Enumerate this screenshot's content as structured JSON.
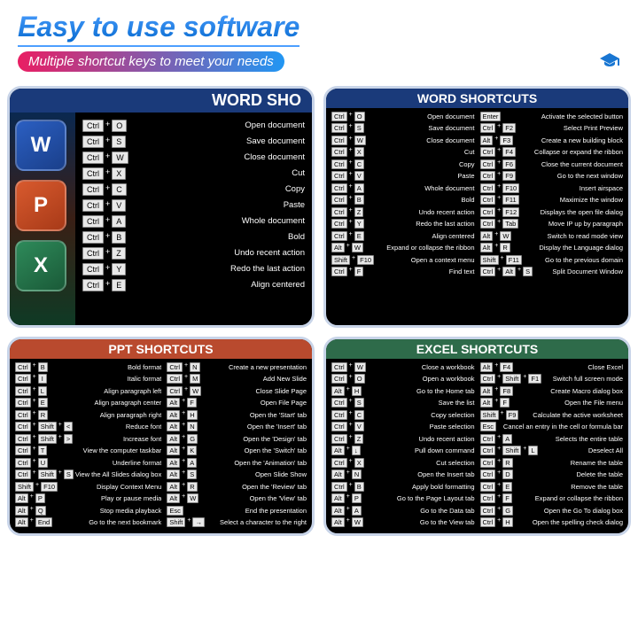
{
  "header": {
    "title": "Easy to use software",
    "subtitle": "Multiple shortcut keys to meet your needs"
  },
  "apps": {
    "w": "W",
    "p": "P",
    "x": "X"
  },
  "panels": {
    "zoom": {
      "title": "WORD SHO",
      "rows": [
        {
          "k": [
            "Ctrl",
            "O"
          ],
          "d": "Open document"
        },
        {
          "k": [
            "Ctrl",
            "S"
          ],
          "d": "Save document"
        },
        {
          "k": [
            "Ctrl",
            "W"
          ],
          "d": "Close document"
        },
        {
          "k": [
            "Ctrl",
            "X"
          ],
          "d": "Cut"
        },
        {
          "k": [
            "Ctrl",
            "C"
          ],
          "d": "Copy"
        },
        {
          "k": [
            "Ctrl",
            "V"
          ],
          "d": "Paste"
        },
        {
          "k": [
            "Ctrl",
            "A"
          ],
          "d": "Whole document"
        },
        {
          "k": [
            "Ctrl",
            "B"
          ],
          "d": "Bold"
        },
        {
          "k": [
            "Ctrl",
            "Z"
          ],
          "d": "Undo recent action"
        },
        {
          "k": [
            "Ctrl",
            "Y"
          ],
          "d": "Redo the last action"
        },
        {
          "k": [
            "Ctrl",
            "E"
          ],
          "d": "Align centered"
        }
      ]
    },
    "word": {
      "title": "WORD SHORTCUTS",
      "left": [
        {
          "k": [
            "Ctrl",
            "O"
          ],
          "d": "Open document"
        },
        {
          "k": [
            "Ctrl",
            "S"
          ],
          "d": "Save document"
        },
        {
          "k": [
            "Ctrl",
            "W"
          ],
          "d": "Close document"
        },
        {
          "k": [
            "Ctrl",
            "X"
          ],
          "d": "Cut"
        },
        {
          "k": [
            "Ctrl",
            "C"
          ],
          "d": "Copy"
        },
        {
          "k": [
            "Ctrl",
            "V"
          ],
          "d": "Paste"
        },
        {
          "k": [
            "Ctrl",
            "A"
          ],
          "d": "Whole document"
        },
        {
          "k": [
            "Ctrl",
            "B"
          ],
          "d": "Bold"
        },
        {
          "k": [
            "Ctrl",
            "Z"
          ],
          "d": "Undo recent action"
        },
        {
          "k": [
            "Ctrl",
            "Y"
          ],
          "d": "Redo the last action"
        },
        {
          "k": [
            "Ctrl",
            "E"
          ],
          "d": "Align centered"
        },
        {
          "k": [
            "Alt",
            "W"
          ],
          "d": "Expand or collapse the ribbon"
        },
        {
          "k": [
            "Shift",
            "F10"
          ],
          "d": "Open a context menu"
        },
        {
          "k": [
            "Ctrl",
            "F"
          ],
          "d": "Find text"
        }
      ],
      "right": [
        {
          "k": [
            "Enter"
          ],
          "d": "Activate the selected button"
        },
        {
          "k": [
            "Ctrl",
            "F2"
          ],
          "d": "Select Print Preview"
        },
        {
          "k": [
            "Alt",
            "F3"
          ],
          "d": "Create a new building block"
        },
        {
          "k": [
            "Ctrl",
            "F4"
          ],
          "d": "Collapse or expand the ribbon"
        },
        {
          "k": [
            "Ctrl",
            "F6"
          ],
          "d": "Close the current document"
        },
        {
          "k": [
            "Ctrl",
            "F9"
          ],
          "d": "Go to the next window"
        },
        {
          "k": [
            "Ctrl",
            "F10"
          ],
          "d": "Insert airspace"
        },
        {
          "k": [
            "Ctrl",
            "F11"
          ],
          "d": "Maximize the window"
        },
        {
          "k": [
            "Ctrl",
            "F12"
          ],
          "d": "Displays the open file dialog"
        },
        {
          "k": [
            "Ctrl",
            "Tab"
          ],
          "d": "Move IP up by paragraph"
        },
        {
          "k": [
            "Alt",
            "W"
          ],
          "d": "Switch to read mode view"
        },
        {
          "k": [
            "Alt",
            "R"
          ],
          "d": "Display the Language dialog"
        },
        {
          "k": [
            "Shift",
            "F11"
          ],
          "d": "Go to the previous domain"
        },
        {
          "k": [
            "Ctrl",
            "Alt",
            "S"
          ],
          "d": "Split Document Window"
        }
      ]
    },
    "ppt": {
      "title": "PPT SHORTCUTS",
      "left": [
        {
          "k": [
            "Ctrl",
            "B"
          ],
          "d": "Bold format"
        },
        {
          "k": [
            "Ctrl",
            "I"
          ],
          "d": "Italic format"
        },
        {
          "k": [
            "Ctrl",
            "L"
          ],
          "d": "Align paragraph left"
        },
        {
          "k": [
            "Ctrl",
            "E"
          ],
          "d": "Align paragraph center"
        },
        {
          "k": [
            "Ctrl",
            "R"
          ],
          "d": "Align paragraph right"
        },
        {
          "k": [
            "Ctrl",
            "Shift",
            "<"
          ],
          "d": "Reduce font"
        },
        {
          "k": [
            "Ctrl",
            "Shift",
            ">"
          ],
          "d": "Increase font"
        },
        {
          "k": [
            "Ctrl",
            "T"
          ],
          "d": "View the computer taskbar"
        },
        {
          "k": [
            "Ctrl",
            "U"
          ],
          "d": "Underline format"
        },
        {
          "k": [
            "Ctrl",
            "Shift",
            "S"
          ],
          "d": "View the All Slides dialog box"
        },
        {
          "k": [
            "Shift",
            "F10"
          ],
          "d": "Display Context Menu"
        },
        {
          "k": [
            "Alt",
            "P"
          ],
          "d": "Play or pause media"
        },
        {
          "k": [
            "Alt",
            "Q"
          ],
          "d": "Stop media playback"
        },
        {
          "k": [
            "Alt",
            "End"
          ],
          "d": "Go to the next bookmark"
        }
      ],
      "right": [
        {
          "k": [
            "Ctrl",
            "N"
          ],
          "d": "Create a new presentation"
        },
        {
          "k": [
            "Ctrl",
            "M"
          ],
          "d": "Add New Slide"
        },
        {
          "k": [
            "Ctrl",
            "W"
          ],
          "d": "Close Slide Page"
        },
        {
          "k": [
            "Alt",
            "F"
          ],
          "d": "Open File Page"
        },
        {
          "k": [
            "Alt",
            "H"
          ],
          "d": "Open the 'Start' tab"
        },
        {
          "k": [
            "Alt",
            "N"
          ],
          "d": "Open the 'Insert' tab"
        },
        {
          "k": [
            "Alt",
            "G"
          ],
          "d": "Open the 'Design' tab"
        },
        {
          "k": [
            "Alt",
            "K"
          ],
          "d": "Open the 'Switch' tab"
        },
        {
          "k": [
            "Alt",
            "A"
          ],
          "d": "Open the 'Animation' tab"
        },
        {
          "k": [
            "Alt",
            "S"
          ],
          "d": "Open Slide Show"
        },
        {
          "k": [
            "Alt",
            "R"
          ],
          "d": "Open the 'Review' tab"
        },
        {
          "k": [
            "Alt",
            "W"
          ],
          "d": "Open the 'View' tab"
        },
        {
          "k": [
            "Esc"
          ],
          "d": "End the presentation"
        },
        {
          "k": [
            "Shift",
            "→"
          ],
          "d": "Select a character to the right"
        }
      ]
    },
    "excel": {
      "title": "EXCEL SHORTCUTS",
      "left": [
        {
          "k": [
            "Ctrl",
            "W"
          ],
          "d": "Close a workbook"
        },
        {
          "k": [
            "Ctrl",
            "O"
          ],
          "d": "Open a workbook"
        },
        {
          "k": [
            "Alt",
            "H"
          ],
          "d": "Go to the Home tab"
        },
        {
          "k": [
            "Ctrl",
            "S"
          ],
          "d": "Save the list"
        },
        {
          "k": [
            "Ctrl",
            "C"
          ],
          "d": "Copy selection"
        },
        {
          "k": [
            "Ctrl",
            "V"
          ],
          "d": "Paste selection"
        },
        {
          "k": [
            "Ctrl",
            "Z"
          ],
          "d": "Undo recent action"
        },
        {
          "k": [
            "Alt",
            "↓"
          ],
          "d": "Pull down command"
        },
        {
          "k": [
            "Ctrl",
            "X"
          ],
          "d": "Cut selection"
        },
        {
          "k": [
            "Alt",
            "N"
          ],
          "d": "Open the Insert tab"
        },
        {
          "k": [
            "Ctrl",
            "B"
          ],
          "d": "Apply bold formatting"
        },
        {
          "k": [
            "Alt",
            "P"
          ],
          "d": "Go to the Page Layout tab"
        },
        {
          "k": [
            "Alt",
            "A"
          ],
          "d": "Go to the Data tab"
        },
        {
          "k": [
            "Alt",
            "W"
          ],
          "d": "Go to the View tab"
        }
      ],
      "right": [
        {
          "k": [
            "Alt",
            "F4"
          ],
          "d": "Close Excel"
        },
        {
          "k": [
            "Ctrl",
            "Shift",
            "F1"
          ],
          "d": "Switch full screen mode"
        },
        {
          "k": [
            "Alt",
            "F8"
          ],
          "d": "Create Macro dialog box"
        },
        {
          "k": [
            "Alt",
            "F"
          ],
          "d": "Open the File menu"
        },
        {
          "k": [
            "Shift",
            "F9"
          ],
          "d": "Calculate the active worksheet"
        },
        {
          "k": [
            "Esc"
          ],
          "d": "Cancel an entry in the cell or formula bar"
        },
        {
          "k": [
            "Ctrl",
            "A"
          ],
          "d": "Selects the entire table"
        },
        {
          "k": [
            "Ctrl",
            "Shift",
            "L"
          ],
          "d": "Deselect All"
        },
        {
          "k": [
            "Ctrl",
            "R"
          ],
          "d": "Rename the table"
        },
        {
          "k": [
            "Ctrl",
            "D"
          ],
          "d": "Delete the table"
        },
        {
          "k": [
            "Ctrl",
            "E"
          ],
          "d": "Remove the table"
        },
        {
          "k": [
            "Ctrl",
            "F"
          ],
          "d": "Expand or collapse the ribbon"
        },
        {
          "k": [
            "Ctrl",
            "G"
          ],
          "d": "Open the Go To dialog box"
        },
        {
          "k": [
            "Ctrl",
            "H"
          ],
          "d": "Open the spelling check dialog"
        }
      ]
    }
  }
}
